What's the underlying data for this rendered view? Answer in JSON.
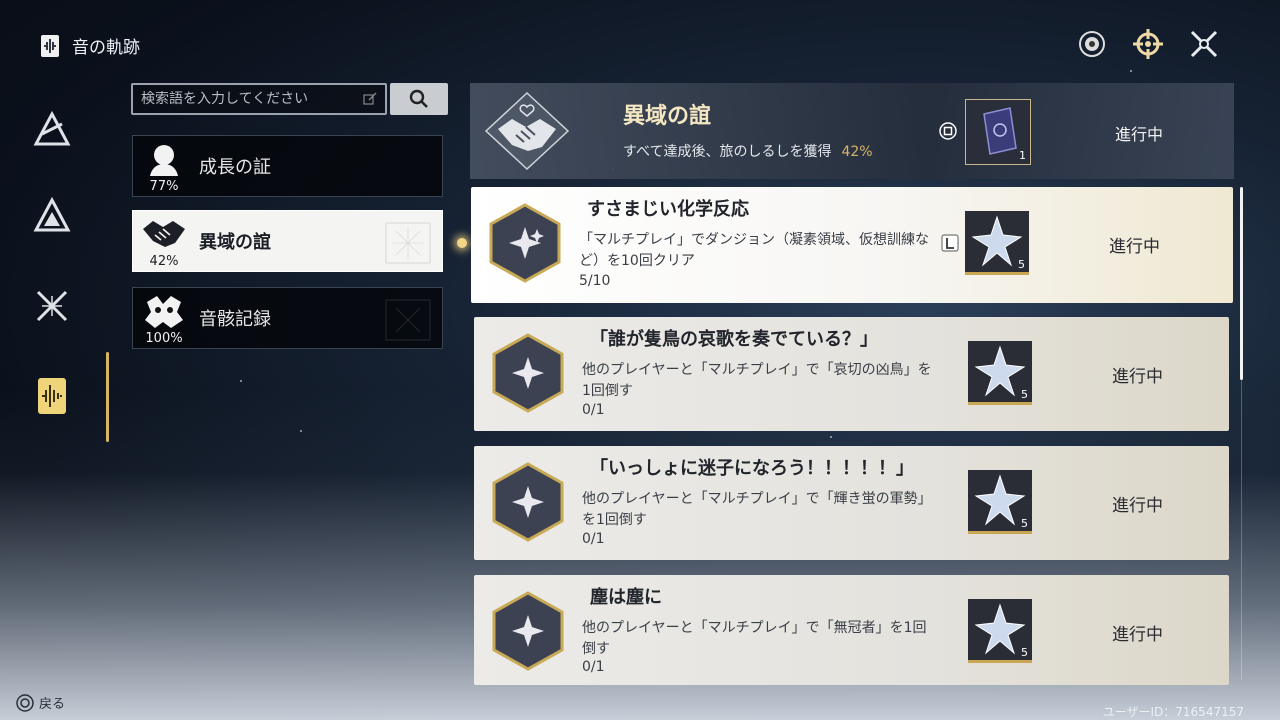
{
  "header": {
    "title": "音の軌跡",
    "icons": [
      "target-icon",
      "compass-icon",
      "crossed-swords-icon"
    ]
  },
  "rail": {
    "icons": [
      "resonance-triangle-icon",
      "mountain-emblem-icon",
      "crossed-blades-icon",
      "soundwave-book-icon"
    ]
  },
  "search": {
    "placeholder": "検索語を入力してください"
  },
  "categories": [
    {
      "label": "成長の証",
      "percent": "77%",
      "icon": "bust-icon"
    },
    {
      "label": "異域の誼",
      "percent": "42%",
      "icon": "handshake-icon",
      "active": true
    },
    {
      "label": "音骸記録",
      "percent": "100%",
      "icon": "echo-creature-icon"
    }
  ],
  "banner": {
    "title": "異域の誼",
    "desc": "すべて達成後、旅のしるしを獲得",
    "percent": "42%",
    "reward_count": "1",
    "status": "進行中"
  },
  "achievements": [
    {
      "title": "すさまじい化学反応",
      "desc": "「マルチプレイ」でダンジョン（凝素領域、仮想訓練など）を10回クリア",
      "progress": "5/10",
      "reward_count": "5",
      "status": "進行中"
    },
    {
      "title": "「誰が隻鳥の哀歌を奏でている？」",
      "desc": "他のプレイヤーと「マルチプレイ」で「哀切の凶鳥」を1回倒す",
      "progress": "0/1",
      "reward_count": "5",
      "status": "進行中"
    },
    {
      "title": "「いっしょに迷子になろう！！！！！」",
      "desc": "他のプレイヤーと「マルチプレイ」で「輝き蛍の軍勢」を1回倒す",
      "progress": "0/1",
      "reward_count": "5",
      "status": "進行中"
    },
    {
      "title": "塵は塵に",
      "desc": "他のプレイヤーと「マルチプレイ」で「無冠者」を1回倒す",
      "progress": "0/1",
      "reward_count": "5",
      "status": "進行中"
    }
  ],
  "footer": {
    "back": "戻る",
    "user_id": "ユーザーID：716547157"
  },
  "colors": {
    "accent_gold": "#d8b468",
    "card_bg": "#ecebe8",
    "active_card_bg": "#ffffff"
  }
}
